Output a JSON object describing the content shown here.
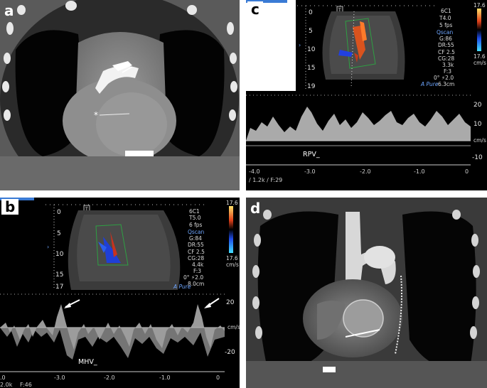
{
  "panels": {
    "a": {
      "label": "a"
    },
    "b": {
      "label": "b",
      "probe": "6C1",
      "params": [
        "T5.0",
        "6 fps",
        "Qscan",
        "G:84",
        "DR:55",
        "CF 2.5",
        "CG:28",
        "4.4k",
        "F:3",
        "0°  ⚡2.0",
        "8.0cm"
      ],
      "depth_ticks": [
        "0",
        "5",
        "10",
        "15",
        "17"
      ],
      "colorbar": {
        "top": "17.6",
        "bottom": "17.6",
        "unit": "cm/s"
      },
      "brand": "Pure",
      "trace": {
        "vessel": "MHV_",
        "scale": [
          "20",
          "cm/s",
          "-20"
        ],
        "time_ticks": [
          "-3.0",
          "-2.0",
          "-1.0",
          "0"
        ],
        "footer": [
          ".0",
          "2.0k",
          "F:46"
        ]
      }
    },
    "c": {
      "label": "c",
      "probe": "6C1",
      "params": [
        "T4.0",
        "5 fps",
        "Qscan",
        "G:86",
        "DR:55",
        "CF 2.5",
        "CG:28",
        "3.3k",
        "F:3",
        "0°  ⚡2.0",
        "6.3cm"
      ],
      "depth_ticks": [
        "0",
        "5",
        "10",
        "15",
        "19"
      ],
      "colorbar": {
        "top": "17.6",
        "bottom": "17.6",
        "unit": "cm/s"
      },
      "brand": "Pure",
      "trace": {
        "vessel": "RPV_",
        "scale": [
          "20",
          "10",
          "cm/s",
          "-10"
        ],
        "time_ticks": [
          "-4.0",
          "-3.0",
          "-2.0",
          "-1.0",
          "0"
        ],
        "footer": [
          "1.2k",
          "F:29"
        ]
      }
    },
    "d": {
      "label": "d"
    }
  }
}
